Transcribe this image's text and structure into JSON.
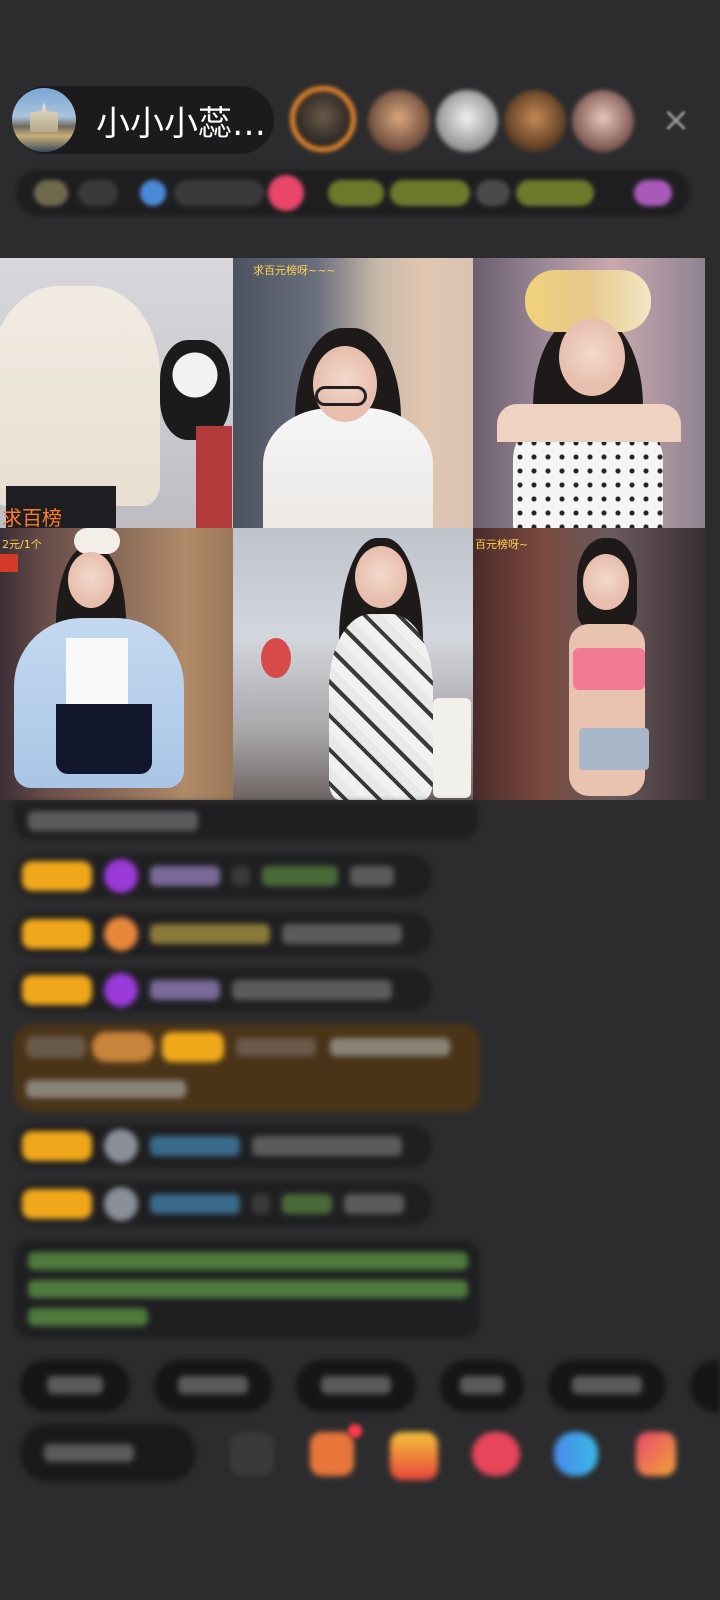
{
  "host": {
    "name": "小小小蕊…"
  },
  "top_bar": {
    "close_icon": "×"
  },
  "grid": {
    "cells": [
      {
        "label": "求百榜"
      },
      {
        "label": "求百元榜呀~~~"
      },
      {
        "label": ""
      },
      {
        "label": "2元/1个"
      },
      {
        "label": ""
      },
      {
        "label": "百元榜呀~"
      }
    ]
  },
  "colors": {
    "badge": "#f0a81a",
    "accent_orange": "#e8872b",
    "background": "#2c2c2e"
  }
}
